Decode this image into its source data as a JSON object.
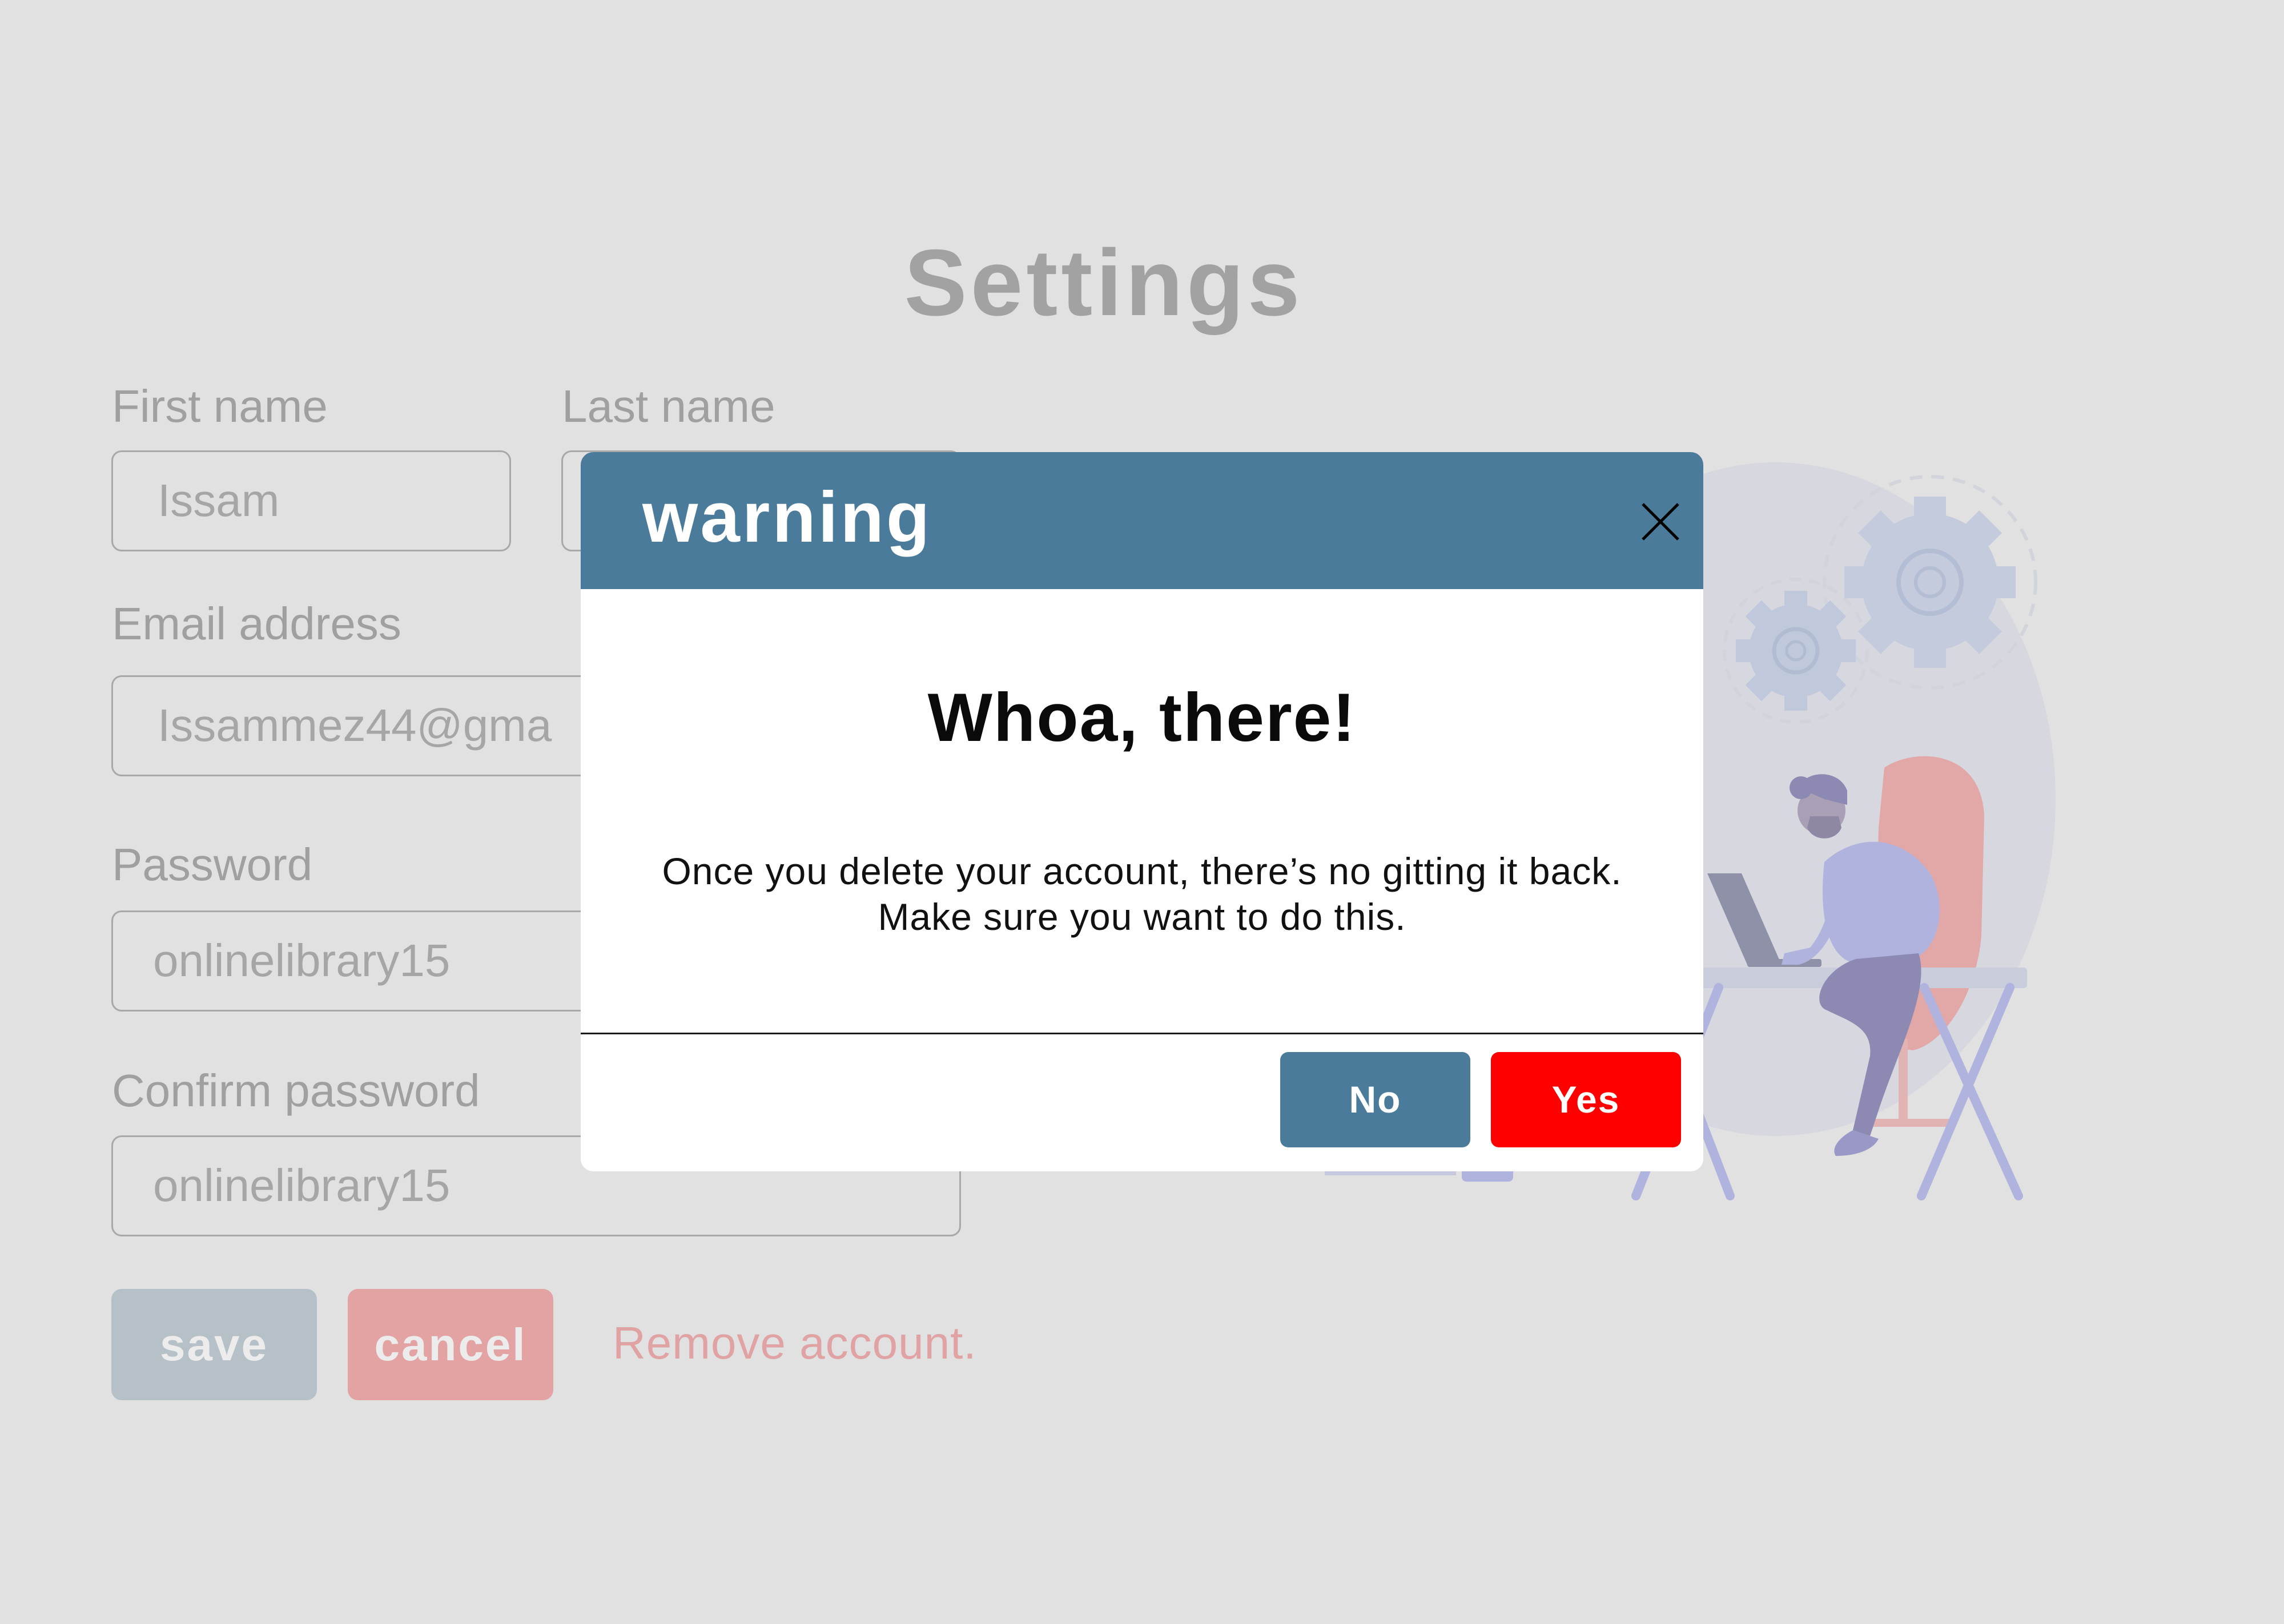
{
  "settings": {
    "title": "Settings",
    "first_name_label": "First name",
    "first_name_value": "Issam",
    "last_name_label": "Last name",
    "email_label": "Email address",
    "email_value": "Issammez44@gma",
    "password_label": "Password",
    "password_value": "onlinelibrary15",
    "confirm_password_label": "Confirm password",
    "confirm_password_value": "onlinelibrary15",
    "save_label": "save",
    "cancel_label": "cancel",
    "remove_account_label": "Remove account."
  },
  "modal": {
    "title": "warning",
    "close_icon": "close-icon",
    "heading": "Whoa, there!",
    "message_line1": "Once you delete your account, there’s no gitting it back.",
    "message_line2": "Make sure you want to do this.",
    "no_label": "No",
    "yes_label": "Yes"
  },
  "colors": {
    "background": "#e1e1e1",
    "modal_header": "#4a7b9b",
    "no_button": "#4a7b9b",
    "yes_button": "#ff0000",
    "save_button": "#b5c0c7",
    "cancel_button": "#e3a3a3",
    "remove_link": "#e0a2a2"
  }
}
